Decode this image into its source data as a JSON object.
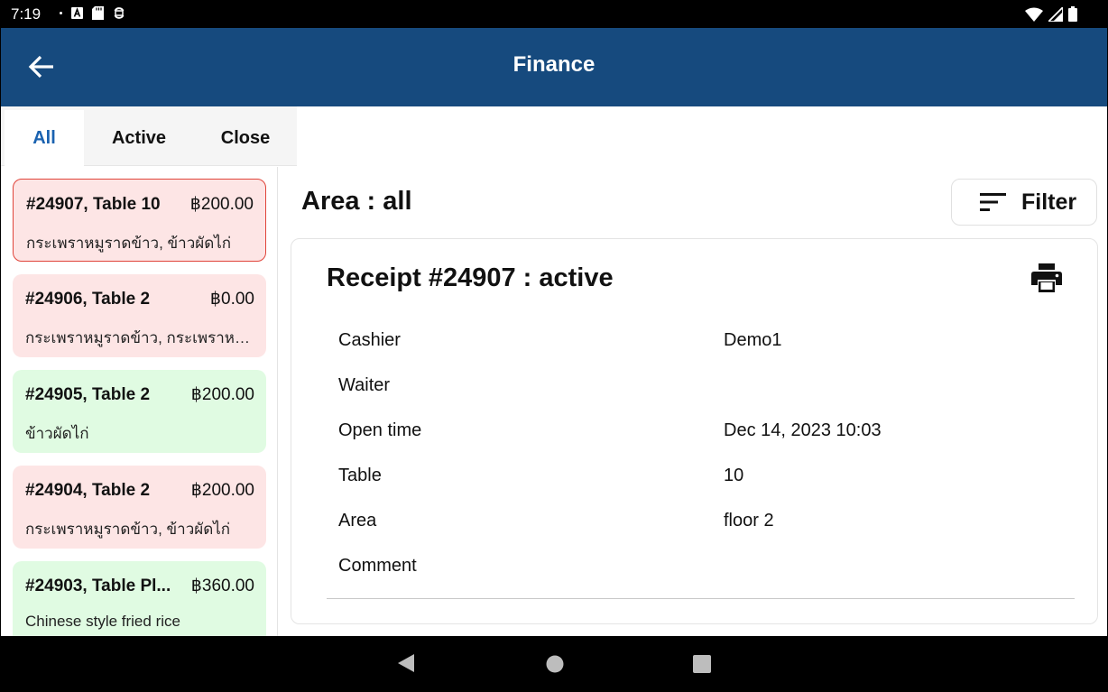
{
  "status": {
    "time": "7:19"
  },
  "appbar": {
    "title": "Finance"
  },
  "tabs": [
    {
      "label": "All",
      "active": true
    },
    {
      "label": "Active",
      "active": false
    },
    {
      "label": "Close",
      "active": false
    }
  ],
  "receipts": [
    {
      "title": "#24907, Table 10",
      "amount": "฿200.00",
      "items": "กระเพราหมูราดข้าว, ข้าวผัดไก่",
      "color": "pink",
      "selected": true
    },
    {
      "title": "#24906, Table 2",
      "amount": "฿0.00",
      "items": "กระเพราหมูราดข้าว, กระเพราหมู...",
      "color": "pink",
      "selected": false
    },
    {
      "title": "#24905, Table 2",
      "amount": "฿200.00",
      "items": "ข้าวผัดไก่",
      "color": "green",
      "selected": false
    },
    {
      "title": "#24904, Table 2",
      "amount": "฿200.00",
      "items": "กระเพราหมูราดข้าว, ข้าวผัดไก่",
      "color": "pink",
      "selected": false
    },
    {
      "title": "#24903, Table Pl...",
      "amount": "฿360.00",
      "items": "Chinese style fried rice",
      "color": "green",
      "selected": false
    }
  ],
  "detail": {
    "area_title": "Area : all",
    "filter_label": "Filter",
    "receipt_title": "Receipt #24907 : active",
    "rows": [
      {
        "label": "Cashier",
        "value": "Demo1"
      },
      {
        "label": "Waiter",
        "value": ""
      },
      {
        "label": "Open time",
        "value": "Dec 14, 2023 10:03"
      },
      {
        "label": "Table",
        "value": "10"
      },
      {
        "label": "Area",
        "value": "floor 2"
      },
      {
        "label": "Comment",
        "value": ""
      }
    ]
  },
  "colors": {
    "appbar": "#164a7e",
    "active_tab": "#1a62b0",
    "card_pink": "#fde5e5",
    "card_green": "#e0fbe2",
    "selected_border": "#e0443a"
  }
}
